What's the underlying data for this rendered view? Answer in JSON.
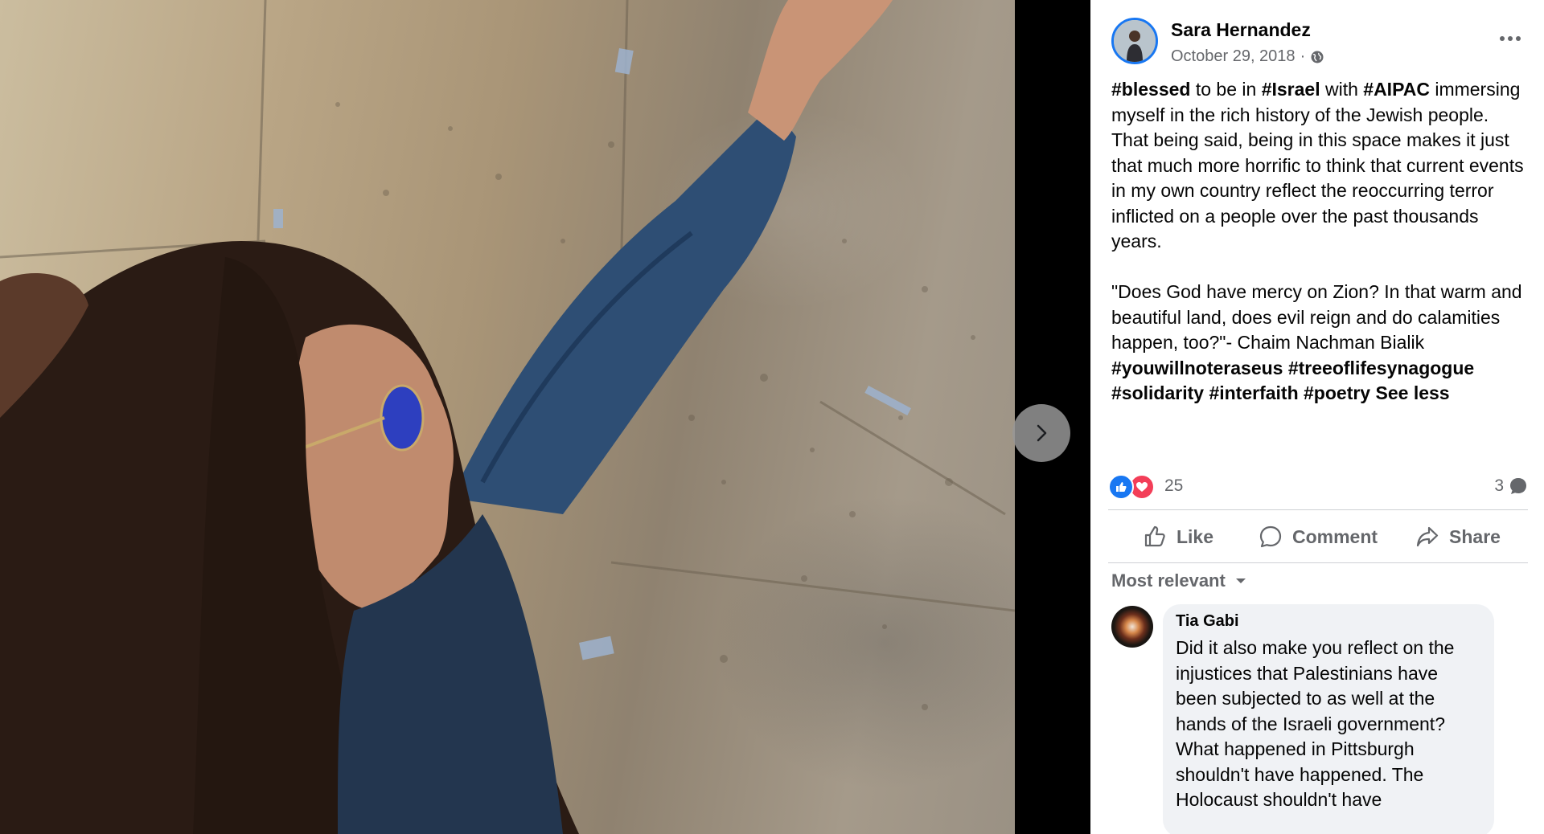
{
  "viewer": {
    "next_icon": "chevron-right-icon"
  },
  "post": {
    "author": "Sara Hernandez",
    "date": "October 29, 2018",
    "separator": "·",
    "privacy_icon": "globe-icon",
    "more_icon": "more-horizontal-icon",
    "text": {
      "p1": [
        {
          "t": "#blessed",
          "tag": true
        },
        {
          "t": " to be in ",
          "tag": false
        },
        {
          "t": "#Israel",
          "tag": true
        },
        {
          "t": " with ",
          "tag": false
        },
        {
          "t": "#AIPAC",
          "tag": true
        },
        {
          "t": " immersing myself in the rich history of the Jewish people. That being said, being in this space makes it just that much more horrific to think that current events in my own country reflect the reoccurring terror inflicted on a people over the past thousands years.",
          "tag": false
        }
      ],
      "p2": [
        {
          "t": "\"Does God have mercy on Zion? In that warm and beautiful land, does evil reign and do calamities happen, too?\"- Chaim Nachman Bialik ",
          "tag": false
        },
        {
          "t": "#youwillnoteraseus",
          "tag": true
        },
        {
          "t": " ",
          "tag": false
        },
        {
          "t": "#treeoflifesynagogue",
          "tag": true
        },
        {
          "t": " ",
          "tag": false
        },
        {
          "t": "#solidarity",
          "tag": true
        },
        {
          "t": " ",
          "tag": false
        },
        {
          "t": "#interfaith",
          "tag": true
        },
        {
          "t": " ",
          "tag": false
        },
        {
          "t": "#poetry",
          "tag": true
        }
      ],
      "see_less": "See less"
    },
    "reactions": {
      "count": "25",
      "types": [
        "like",
        "love"
      ],
      "comments_count": "3"
    },
    "actions": {
      "like": "Like",
      "comment": "Comment",
      "share": "Share"
    }
  },
  "comments": {
    "sort_label": "Most relevant",
    "items": [
      {
        "author": "Tia Gabi",
        "text": "Did it also make you reflect on the injustices that Palestinians have been subjected to as well at the hands of the Israeli government? What happened in Pittsburgh shouldn't have happened. The Holocaust shouldn't have"
      }
    ]
  },
  "colors": {
    "accent": "#1877f2",
    "love": "#f33e58",
    "secondary_text": "#65676b",
    "bubble_bg": "#f0f2f5"
  }
}
